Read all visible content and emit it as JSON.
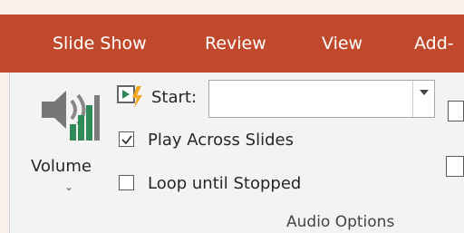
{
  "tabs": [
    {
      "label": "Slide Show"
    },
    {
      "label": "Review"
    },
    {
      "label": "View"
    },
    {
      "label": "Add-"
    }
  ],
  "volume": {
    "label": "Volume",
    "icon": "speaker-volume-icon"
  },
  "start": {
    "label": "Start:",
    "icon": "start-trigger-icon",
    "value": ""
  },
  "play_across_slides": {
    "label": "Play Across Slides",
    "checked": true
  },
  "loop_until_stopped": {
    "label": "Loop until Stopped",
    "checked": false
  },
  "group": {
    "label": "Audio Options"
  },
  "colors": {
    "tab_bar": "#c1492b",
    "ribbon": "#f3f3f3",
    "accent_green": "#2f8a57"
  }
}
